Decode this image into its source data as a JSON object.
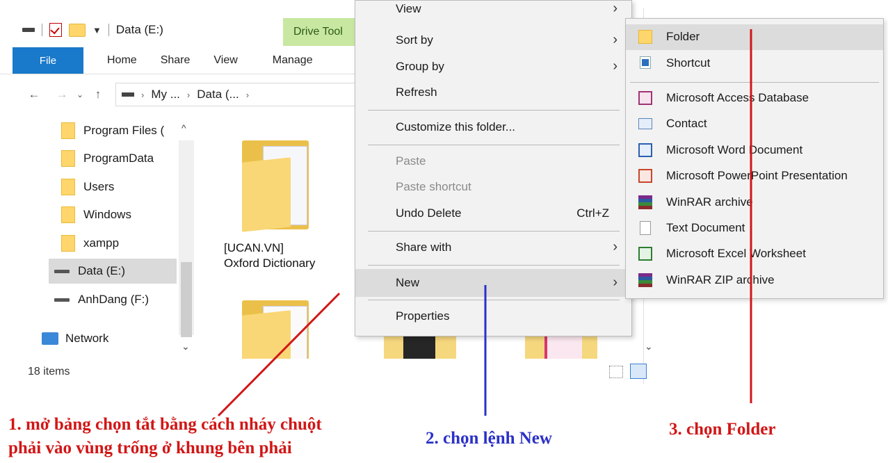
{
  "window": {
    "title": "Data (E:)",
    "context_tab": "Drive Tool",
    "tabs": [
      "File",
      "Home",
      "Share",
      "View",
      "Manage"
    ],
    "breadcrumb": [
      "My ...",
      "Data (..."
    ],
    "status": "18 items"
  },
  "nav_pane": {
    "items": [
      {
        "label": "Program Files (",
        "icon": "folder-icon"
      },
      {
        "label": "ProgramData",
        "icon": "folder-icon"
      },
      {
        "label": "Users",
        "icon": "folder-icon"
      },
      {
        "label": "Windows",
        "icon": "folder-icon"
      },
      {
        "label": "xampp",
        "icon": "folder-icon"
      },
      {
        "label": "Data (E:)",
        "icon": "drive-icon",
        "selected": true
      },
      {
        "label": "AnhDang (F:)",
        "icon": "drive-icon"
      },
      {
        "label": "Network",
        "icon": "network-icon"
      }
    ]
  },
  "content": {
    "folder_label_line1": "[UCAN.VN]",
    "folder_label_line2": "Oxford Dictionary"
  },
  "context_menu": {
    "items": [
      {
        "label": "View",
        "arrow": true
      },
      {
        "label": "Sort by",
        "arrow": true
      },
      {
        "label": "Group by",
        "arrow": true
      },
      {
        "label": "Refresh"
      },
      {
        "label": "Customize this folder..."
      },
      {
        "label": "Paste",
        "disabled": true
      },
      {
        "label": "Paste shortcut",
        "disabled": true
      },
      {
        "label": "Undo Delete",
        "shortcut": "Ctrl+Z"
      },
      {
        "label": "Share with",
        "arrow": true
      },
      {
        "label": "New",
        "arrow": true,
        "highlighted": true
      },
      {
        "label": "Properties"
      }
    ]
  },
  "new_submenu": {
    "items": [
      {
        "label": "Folder",
        "icon": "folder-icon",
        "highlighted": true
      },
      {
        "label": "Shortcut",
        "icon": "shortcut-icon"
      },
      {
        "label": "Microsoft Access Database",
        "icon": "access-icon"
      },
      {
        "label": "Contact",
        "icon": "contact-icon"
      },
      {
        "label": "Microsoft Word Document",
        "icon": "word-icon"
      },
      {
        "label": "Microsoft PowerPoint Presentation",
        "icon": "powerpoint-icon"
      },
      {
        "label": "WinRAR archive",
        "icon": "winrar-icon"
      },
      {
        "label": "Text Document",
        "icon": "text-document-icon"
      },
      {
        "label": "Microsoft Excel Worksheet",
        "icon": "excel-icon"
      },
      {
        "label": "WinRAR ZIP archive",
        "icon": "winrar-zip-icon"
      }
    ]
  },
  "annotations": {
    "step1_line1": "1. mở bảng chọn tắt bằng cách nháy chuột",
    "step1_line2": "phải vào vùng trống ở khung bên phải",
    "step2": "2. chọn lệnh New",
    "step3": "3. chọn Folder",
    "color_red": "#d11616",
    "color_blue": "#2b31c6"
  }
}
